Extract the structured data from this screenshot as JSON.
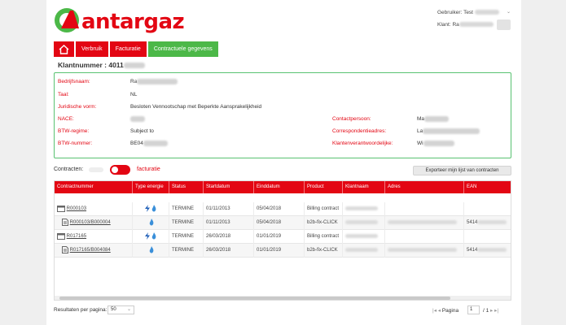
{
  "brand": {
    "name": "antargaz",
    "accent": "#e30613",
    "green": "#4cb848"
  },
  "header": {
    "user_label": "Gebruiker:",
    "user_value": "Test",
    "client_label": "Klant:",
    "client_value": "Ra"
  },
  "nav": {
    "verbruik": "Verbruik",
    "facturatie": "Facturatie",
    "contractuele": "Contractuele gegevens"
  },
  "klant": {
    "label": "Klantnummer : 4011"
  },
  "info": {
    "bedrijfsnaam_label": "Bedrijfsnaam:",
    "bedrijfsnaam_value": "Ra",
    "taal_label": "Taal:",
    "taal_value": "NL",
    "juridische_label": "Juridische vorm:",
    "juridische_value": "Besloten Vennootschap met Beperkte Aansprakelijkheid",
    "nace_label": "NACE:",
    "btw_regime_label": "BTW-regime:",
    "btw_regime_value": "Subject to",
    "btw_nummer_label": "BTW-nummer:",
    "btw_nummer_value": "BE04",
    "contactpersoon_label": "Contactpersoon:",
    "contactpersoon_value": "Ma",
    "correspondentie_label": "Correspondentieadres:",
    "correspondentie_value": "La",
    "klantenver_label": "Klantenverantwoordelijke:",
    "klantenver_value": "Wi"
  },
  "contracts": {
    "label": "Contracten:",
    "toggle_label": "facturatie",
    "export_label": "Exporteer mijn lijst van contracten"
  },
  "table": {
    "headers": [
      "Contractnummer",
      "Type energie",
      "Status",
      "Startdatum",
      "Einddatum",
      "Product",
      "Klantnaam",
      "Adres",
      "EAN"
    ],
    "rows": [
      {
        "contract": "R000103",
        "status": "TERMINE",
        "start": "01/11/2013",
        "end": "05/04/2018",
        "product": "Billing contract",
        "ean": ""
      },
      {
        "contract": "R000103/B000004",
        "status": "TERMINE",
        "start": "01/11/2013",
        "end": "05/04/2018",
        "product": "b2b-fix-CLICK",
        "ean": "5414"
      },
      {
        "contract": "R017165",
        "status": "TERMINE",
        "start": "26/03/2018",
        "end": "01/01/2019",
        "product": "Billing contract",
        "ean": ""
      },
      {
        "contract": "R017165/B004084",
        "status": "TERMINE",
        "start": "26/03/2018",
        "end": "01/01/2019",
        "product": "b2b-fix-CLICK",
        "ean": "5414"
      }
    ]
  },
  "footer": {
    "per_page_label": "Resultaten per pagina:",
    "per_page_value": "50",
    "page_label": "Pagina",
    "page_value": "1",
    "page_total": "/ 1"
  },
  "icons": {
    "home": "home-icon",
    "energy": "lightning-icon",
    "flame": "flame-icon",
    "contract": "contract-icon",
    "document": "document-icon"
  }
}
